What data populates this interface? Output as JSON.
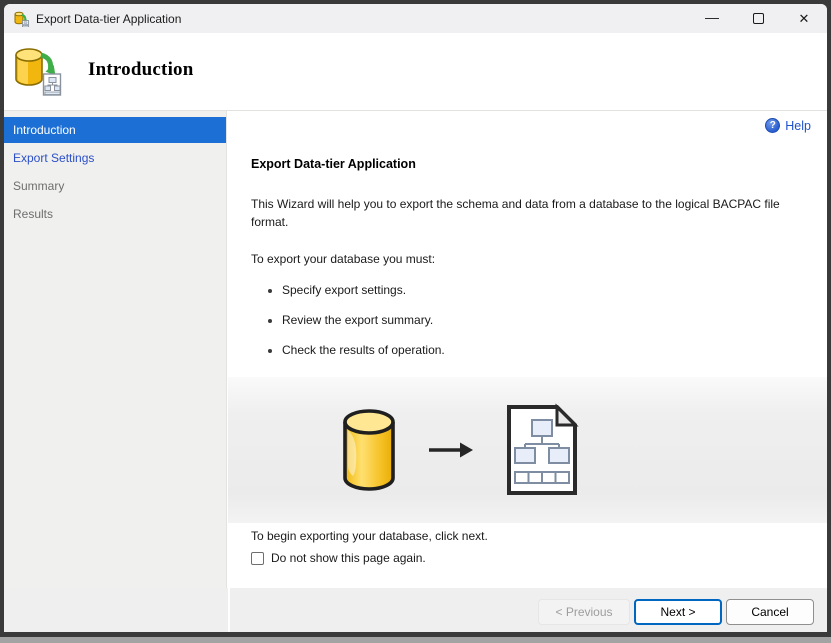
{
  "window": {
    "title": "Export Data-tier Application",
    "controls": {
      "minimize": "—",
      "close": "✕"
    }
  },
  "header": {
    "title": "Introduction"
  },
  "sidebar": {
    "items": [
      {
        "label": "Introduction",
        "state": "active"
      },
      {
        "label": "Export Settings",
        "state": "link"
      },
      {
        "label": "Summary",
        "state": "disabled"
      },
      {
        "label": "Results",
        "state": "disabled"
      }
    ]
  },
  "content": {
    "help_label": "Help",
    "heading": "Export Data-tier Application",
    "intro": "This Wizard will help you to export the schema and data from a database to the logical BACPAC file format.",
    "list_intro": "To export your database you must:",
    "bullets": [
      "Specify export settings.",
      "Review the export summary.",
      "Check the results of operation."
    ],
    "closing": "To begin exporting your database, click next.",
    "checkbox_label": "Do not show this page again.",
    "checkbox_checked": false
  },
  "footer": {
    "buttons": [
      {
        "label": "< Previous",
        "state": "disabled"
      },
      {
        "label": "Next >",
        "state": "default"
      },
      {
        "label": "Cancel",
        "state": "normal"
      }
    ]
  },
  "colors": {
    "accent_selected": "#1c6fd4",
    "link_blue": "#2b4fc8",
    "next_border": "#0067c0",
    "titlebar_bg": "#f0f0f3",
    "sidebar_bg": "#f0f0ee",
    "footer_bg": "#efefef",
    "db_yellow": "#f6c63a"
  }
}
